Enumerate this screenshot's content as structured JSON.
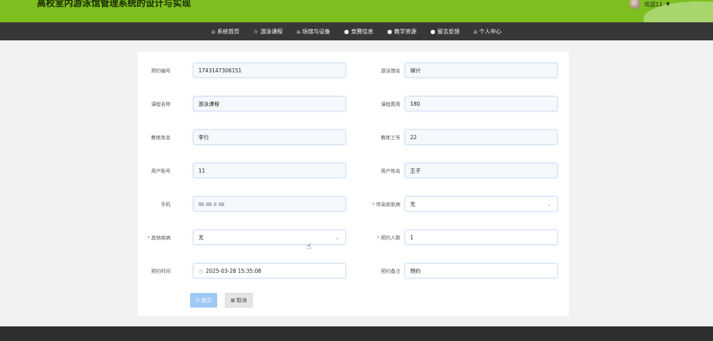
{
  "header": {
    "title": "高校室内游泳馆管理系统的设计与实现",
    "user_label": "欢迎11"
  },
  "nav": {
    "items": [
      {
        "label": "系统首页",
        "icon": "home-icon"
      },
      {
        "label": "游泳课程",
        "icon": "star-icon"
      },
      {
        "label": "场馆与设备",
        "icon": "lock-icon"
      },
      {
        "label": "竞赛信息",
        "icon": "info-icon"
      },
      {
        "label": "教学资源",
        "icon": "help-icon"
      },
      {
        "label": "留言反馈",
        "icon": "info-icon"
      },
      {
        "label": "个人中心",
        "icon": "home-icon"
      }
    ]
  },
  "form": {
    "booking_no": {
      "label": "预约编号",
      "value": "1743147306151"
    },
    "venue_name": {
      "label": "游泳馆名",
      "value": "得兴"
    },
    "course_name": {
      "label": "课程名称",
      "value": "游泳课程"
    },
    "course_fee": {
      "label": "课程费用",
      "value": "180"
    },
    "coach_name": {
      "label": "教练姓名",
      "value": "李行"
    },
    "coach_id": {
      "label": "教练工号",
      "value": "22"
    },
    "user_account": {
      "label": "用户账号",
      "value": "11"
    },
    "user_name": {
      "label": "用户姓名",
      "value": "王子"
    },
    "phone": {
      "label": "手机",
      "value": ""
    },
    "skin_disease": {
      "label": "传染皮肤病",
      "value": "无"
    },
    "other_disease": {
      "label": "其他疾病",
      "value": "无"
    },
    "people_count": {
      "label": "预约人数",
      "value": "1"
    },
    "booking_time": {
      "label": "预约时间",
      "value": "2025-03-28 15:35:08"
    },
    "remark": {
      "label": "预约备注",
      "value": "预约"
    }
  },
  "buttons": {
    "submit": "提交",
    "cancel": "取消"
  },
  "colors": {
    "header_bg": "#7cbf1f",
    "nav_bg": "#373737",
    "submit_bg": "#9ec9f5",
    "required": "#f44444"
  }
}
